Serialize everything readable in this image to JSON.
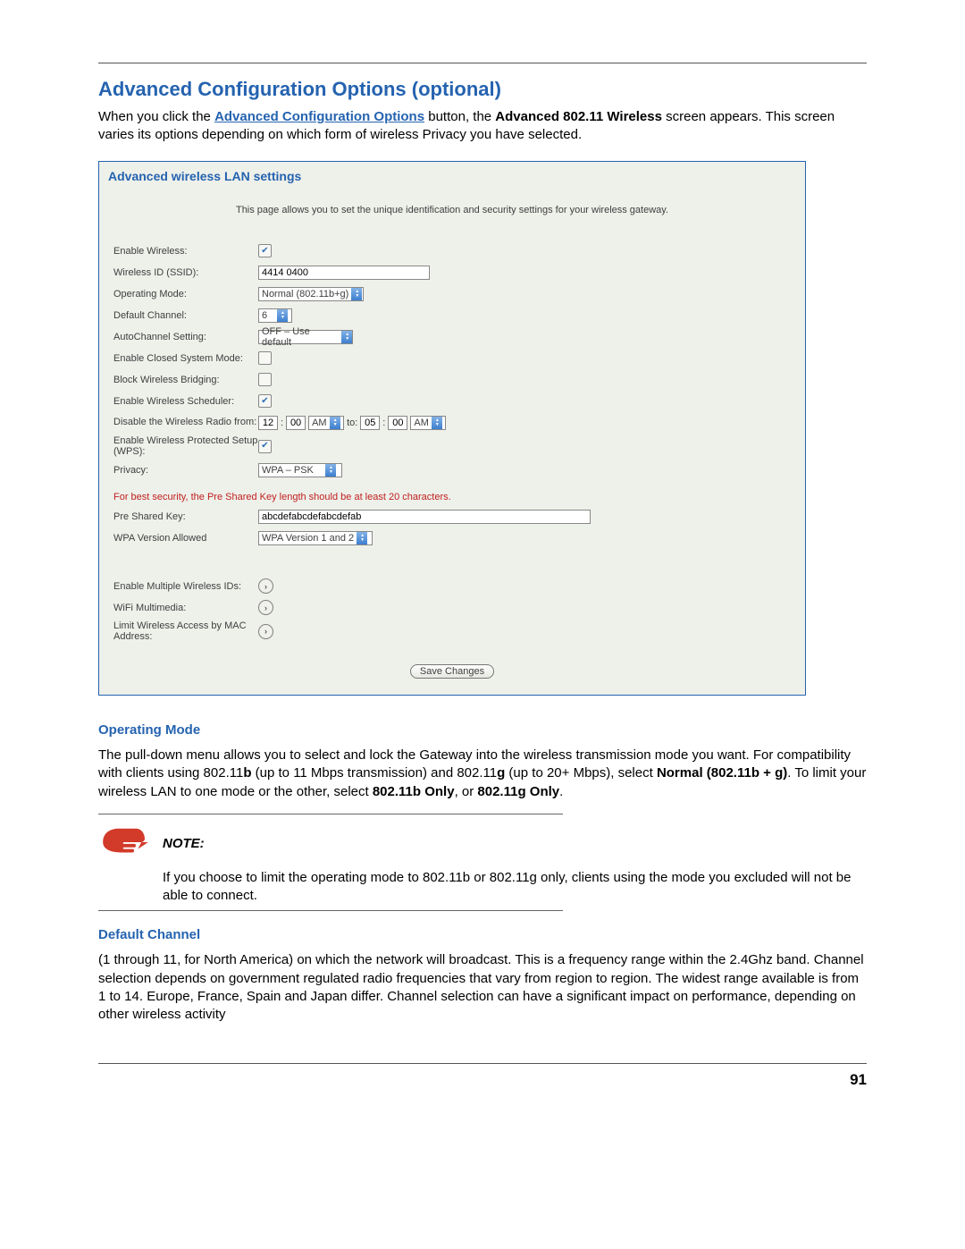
{
  "heading": "Advanced Configuration Options (optional)",
  "intro": {
    "pre": "When you click the ",
    "link": "Advanced Configuration Options",
    "mid": " button, the ",
    "bold": "Advanced 802.11 Wireless",
    "post": " screen appears. This screen varies its options depending on which form of wireless Privacy you have selected."
  },
  "panel": {
    "title": "Advanced wireless LAN settings",
    "desc": "This page allows you to set the unique identification and security settings for your wireless gateway.",
    "labels": {
      "enable_wireless": "Enable Wireless:",
      "ssid": "Wireless ID (SSID):",
      "operating_mode": "Operating Mode:",
      "default_channel": "Default Channel:",
      "autochannel": "AutoChannel Setting:",
      "closed_system": "Enable Closed System Mode:",
      "block_bridging": "Block Wireless Bridging:",
      "scheduler": "Enable Wireless Scheduler:",
      "disable_radio": "Disable the Wireless Radio from:",
      "wps": "Enable Wireless Protected Setup (WPS):",
      "privacy": "Privacy:",
      "psk": "Pre Shared Key:",
      "wpa_version": "WPA Version Allowed",
      "multi_ids": "Enable Multiple Wireless IDs:",
      "wifi_mm": "WiFi Multimedia:",
      "mac_limit": "Limit Wireless Access by MAC Address:"
    },
    "values": {
      "ssid": "4414 0400",
      "operating_mode": "Normal (802.11b+g)",
      "default_channel": "6",
      "autochannel": "OFF – Use default",
      "from_h": "12",
      "from_m": "00",
      "from_ampm": "AM",
      "to_label": "to:",
      "to_h": "05",
      "to_m": "00",
      "to_ampm": "AM",
      "privacy": "WPA – PSK",
      "psk": "abcdefabcdefabcdefab",
      "wpa_version": "WPA Version 1 and 2"
    },
    "warning": "For best security, the Pre Shared Key length should be at least 20 characters.",
    "save": "Save Changes"
  },
  "op_mode_heading": "Operating Mode",
  "op_mode_text": {
    "a": "The pull-down menu allows you to select and lock the Gateway into the wireless transmission mode you want. For compatibility with clients using 802.11",
    "b1": "b",
    "b": " (up to 11 Mbps transmission) and 802.11",
    "g1": "g",
    "c": " (up to 20+ Mbps), select ",
    "normal": "Normal (802.11b + g)",
    "d": ". To limit your wireless LAN to one mode or the other, select ",
    "bonly": "802.11b Only",
    "or": ", or ",
    "gonly": "802.11g Only",
    "e": "."
  },
  "note": {
    "label": "NOTE:",
    "text": "If you choose to limit the operating mode to 802.11b or 802.11g only, clients using the mode you excluded will not be able to connect."
  },
  "default_channel_heading": "Default Channel",
  "default_channel_text": "(1 through 11, for North America) on which the network will broadcast. This is a frequency range within the 2.4Ghz band. Channel selection depends on government regulated radio frequencies that vary from region to region. The widest range available is from 1 to 14. Europe, France, Spain and Japan differ. Channel selection can have a significant impact on performance, depending on other wireless activity",
  "page_number": "91"
}
